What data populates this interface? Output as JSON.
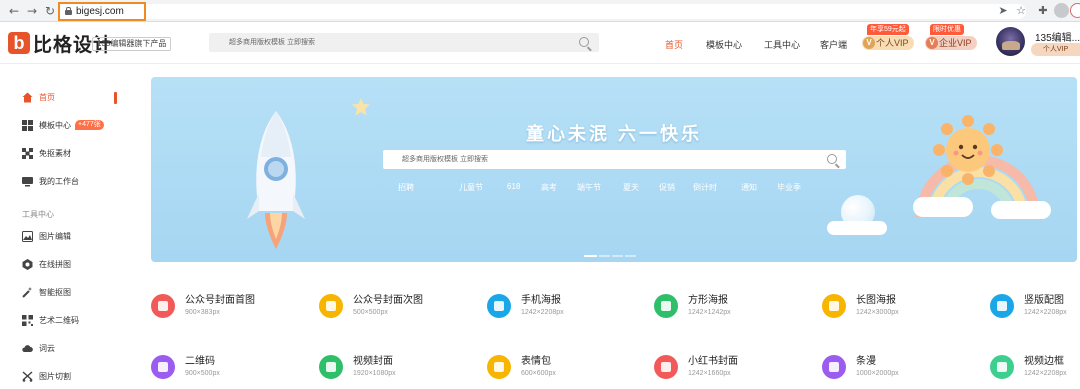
{
  "browser": {
    "url": "bigesj.com",
    "back_icon": "back-arrow-icon",
    "forward_icon": "forward-arrow-icon",
    "reload_icon": "reload-icon"
  },
  "header": {
    "logo_text": "比格设计",
    "logo_letter": "b",
    "brand_tag": "135编辑器旗下产品",
    "search_placeholder": "超多商用版权模板 立即搜索",
    "nav": [
      "首页",
      "模板中心",
      "工具中心",
      "客户端"
    ],
    "vip_personal": {
      "label": "个人VIP",
      "promo": "年享59元起"
    },
    "vip_enterprise": {
      "label": "企业VIP",
      "promo": "限时优惠"
    },
    "user_name": "135编辑...",
    "user_level": "个人VIP",
    "accent_color": "#e8542a"
  },
  "sidebar": {
    "items": [
      {
        "label": "首页",
        "icon": "home-icon"
      },
      {
        "label": "模板中心",
        "icon": "grid-icon",
        "badge": "+477张"
      },
      {
        "label": "免抠素材",
        "icon": "material-icon"
      },
      {
        "label": "我的工作台",
        "icon": "monitor-icon"
      }
    ],
    "tools_title": "工具中心",
    "tools": [
      {
        "label": "图片编辑",
        "icon": "image-edit-icon"
      },
      {
        "label": "在线拼图",
        "icon": "collage-icon"
      },
      {
        "label": "智能抠图",
        "icon": "magic-wand-icon"
      },
      {
        "label": "艺术二维码",
        "icon": "qrcode-icon"
      },
      {
        "label": "词云",
        "icon": "cloud-icon"
      },
      {
        "label": "图片切割",
        "icon": "scissors-icon"
      }
    ]
  },
  "banner": {
    "title": "童心未泯  六一快乐",
    "search_placeholder": "超多商用版权模板 立即搜索",
    "tags": [
      "招聘",
      "儿童节",
      "618",
      "高考",
      "端午节",
      "夏天",
      "促销",
      "倒计时",
      "通知",
      "毕业季"
    ]
  },
  "categories": [
    {
      "name": "公众号封面首图",
      "size": "900×383px",
      "color": "#f25a5a"
    },
    {
      "name": "公众号封面次图",
      "size": "500×500px",
      "color": "#f7b500"
    },
    {
      "name": "手机海报",
      "size": "1242×2208px",
      "color": "#1aa7e8"
    },
    {
      "name": "方形海报",
      "size": "1242×1242px",
      "color": "#2fbf6a"
    },
    {
      "name": "长图海报",
      "size": "1242×3000px",
      "color": "#f7b500"
    },
    {
      "name": "竖版配图",
      "size": "1242×2208px",
      "color": "#1aa7e8"
    },
    {
      "name": "二维码",
      "size": "900×500px",
      "color": "#9b5cf0"
    },
    {
      "name": "视频封面",
      "size": "1920×1080px",
      "color": "#2fbf6a"
    },
    {
      "name": "表情包",
      "size": "600×600px",
      "color": "#f7b500"
    },
    {
      "name": "小红书封面",
      "size": "1242×1660px",
      "color": "#f25a5a"
    },
    {
      "name": "条漫",
      "size": "1000×2000px",
      "color": "#9b5cf0"
    },
    {
      "name": "视频边框",
      "size": "1242×2208px",
      "color": "#3ccf8e"
    }
  ]
}
